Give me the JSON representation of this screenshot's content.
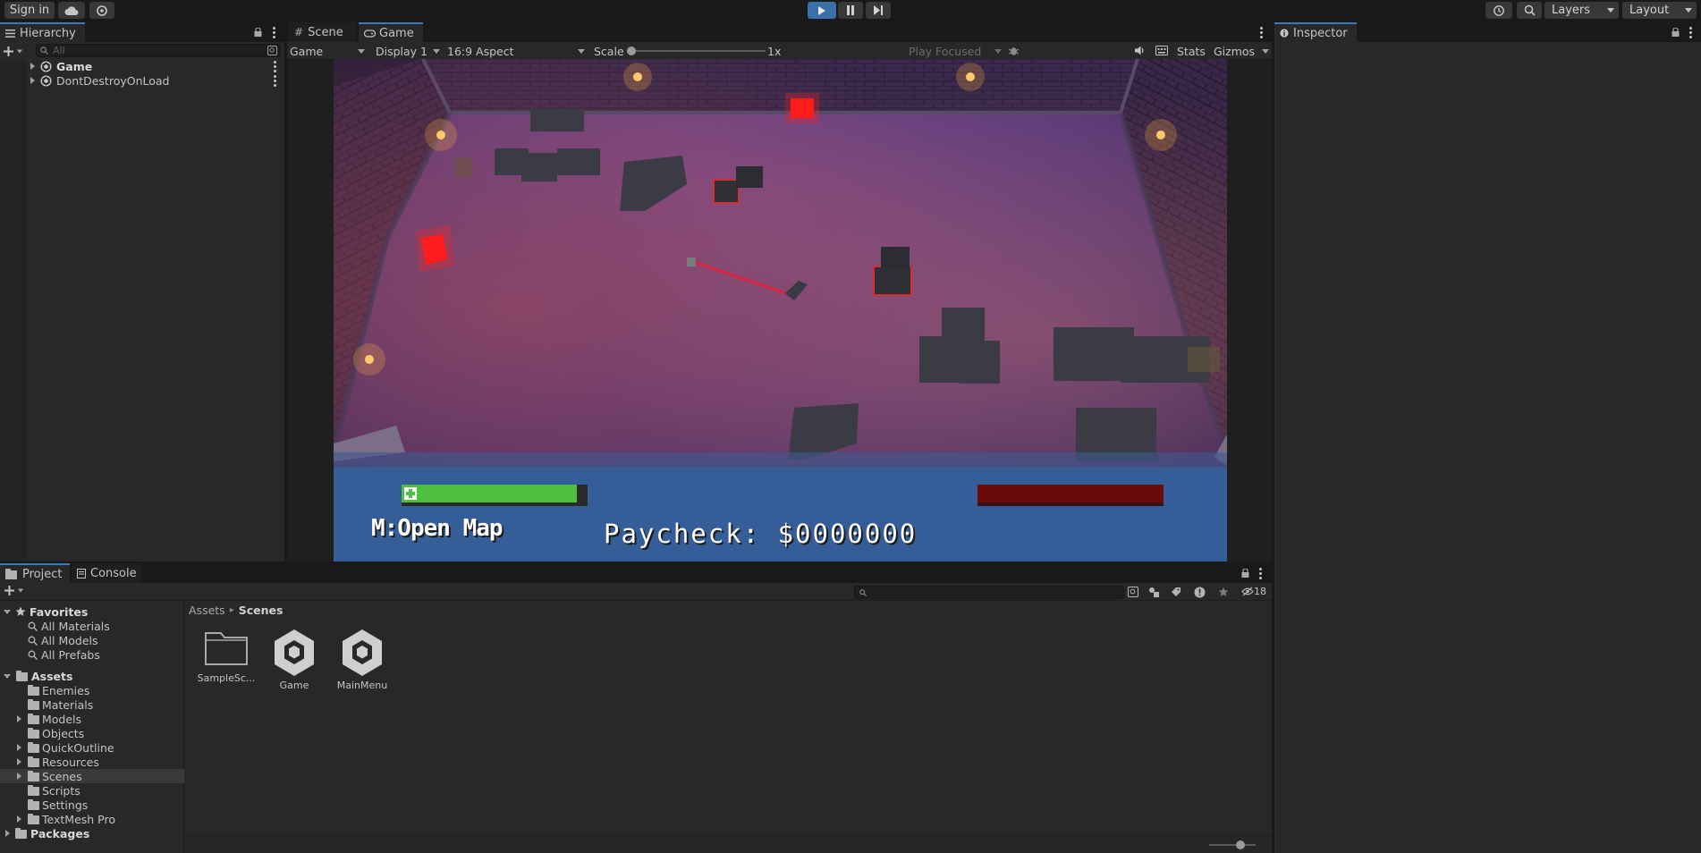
{
  "toolbar": {
    "sign_in": "Sign in",
    "layers": "Layers",
    "layout": "Layout"
  },
  "hierarchy": {
    "tab": "Hierarchy",
    "search_placeholder": "All",
    "items": [
      {
        "label": "Game"
      },
      {
        "label": "DontDestroyOnLoad"
      }
    ]
  },
  "scene_view": {
    "tabs": [
      {
        "label": "Scene"
      },
      {
        "label": "Game"
      }
    ],
    "controls": {
      "mode": "Game",
      "display": "Display 1",
      "aspect": "16:9 Aspect",
      "scale_label": "Scale",
      "scale_value": "1x",
      "play_mode": "Play Focused",
      "stats": "Stats",
      "gizmos": "Gizmos"
    }
  },
  "game_hud": {
    "health_fraction": 0.94,
    "enemy_bar_fraction": 1.0,
    "map_hint": "M:Open Map",
    "paycheck": "Paycheck: $0000000",
    "colors": {
      "health": "#4fbf3f",
      "enemy": "#6b0a0a",
      "laser": "#e0213d",
      "beacon": "#ff1a1a"
    }
  },
  "inspector": {
    "tab": "Inspector"
  },
  "project": {
    "tabs": [
      {
        "label": "Project"
      },
      {
        "label": "Console"
      }
    ],
    "hidden_count": "18",
    "breadcrumb": [
      "Assets",
      "Scenes"
    ],
    "favorites": {
      "label": "Favorites",
      "items": [
        {
          "label": "All Materials"
        },
        {
          "label": "All Models"
        },
        {
          "label": "All Prefabs"
        }
      ]
    },
    "assets": {
      "label": "Assets",
      "items": [
        {
          "label": "Enemies"
        },
        {
          "label": "Materials"
        },
        {
          "label": "Models"
        },
        {
          "label": "Objects"
        },
        {
          "label": "QuickOutline"
        },
        {
          "label": "Resources"
        },
        {
          "label": "Scenes"
        },
        {
          "label": "Scripts"
        },
        {
          "label": "Settings"
        },
        {
          "label": "TextMesh Pro"
        }
      ]
    },
    "packages": "Packages",
    "grid_items": [
      {
        "label": "SampleSc...",
        "kind": "folder"
      },
      {
        "label": "Game",
        "kind": "unity-scene"
      },
      {
        "label": "MainMenu",
        "kind": "unity-scene"
      }
    ]
  },
  "icons": [
    "cloud-icon",
    "collab-icon",
    "play-icon",
    "pause-icon",
    "step-icon",
    "history-icon",
    "search-icon",
    "lock-icon",
    "unity-icon",
    "folder-icon",
    "star-icon"
  ]
}
